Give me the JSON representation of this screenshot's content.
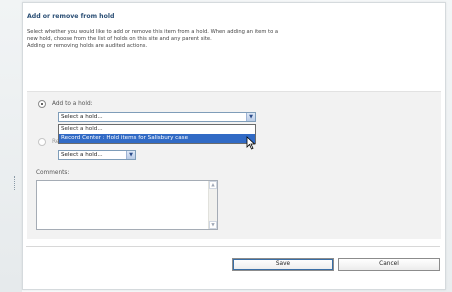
{
  "dialog": {
    "title": "Add or remove from hold",
    "description_lines": [
      "Select whether you would like to add or remove this item from a hold. When adding an item to a",
      "new hold, choose from the list of holds on this site and any parent site.",
      "Adding or removing holds are audited actions."
    ]
  },
  "form": {
    "add_label": "Add to a hold:",
    "add_select_value": "Select a hold...",
    "dropdown_options": [
      "Select a hold...",
      "Record Center : Hold items for Salisbury case"
    ],
    "dropdown_selected_index": 1,
    "remove_label": "Remove from a hold:",
    "remove_select_value": "Select a hold...",
    "comments_label": "Comments:",
    "comments_value": ""
  },
  "buttons": {
    "save": "Save",
    "cancel": "Cancel"
  },
  "icons": {
    "dropdown_arrow": "chevron-down-icon",
    "scroll_up": "scroll-up-icon",
    "scroll_down": "scroll-down-icon",
    "cursor": "mouse-pointer-icon"
  }
}
